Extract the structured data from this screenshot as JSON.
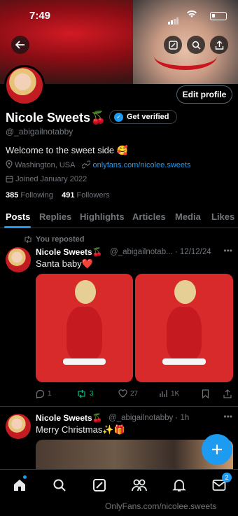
{
  "status_bar": {
    "time": "7:49"
  },
  "profile": {
    "name": "Nicole Sweets🍒",
    "handle": "@_abigailnotabby",
    "get_verified_label": "Get verified",
    "edit_profile_label": "Edit profile",
    "bio": "Welcome to the sweet side 🥰",
    "location": "Washington, USA",
    "website": "onlyfans.com/nicolee.sweets",
    "joined": "Joined January 2022",
    "following_count": "385",
    "following_label": "Following",
    "followers_count": "491",
    "followers_label": "Followers"
  },
  "tabs": [
    {
      "label": "Posts"
    },
    {
      "label": "Replies"
    },
    {
      "label": "Highlights"
    },
    {
      "label": "Articles"
    },
    {
      "label": "Media"
    },
    {
      "label": "Likes"
    }
  ],
  "posts": [
    {
      "repost_label": "You reposted",
      "author": "Nicole Sweets🍒",
      "meta": "@_abigailnotab... · 12/12/24",
      "text": "Santa baby❤️",
      "replies": "1",
      "reposts": "3",
      "likes": "27",
      "views": "1K"
    },
    {
      "author": "Nicole Sweets🍒",
      "meta": "@_abigailnotabby · 1h",
      "text": "Merry Christmas✨🎁"
    }
  ],
  "messages_badge": "2",
  "watermark": "OnlyFans.com/nicolee.sweets",
  "colors": {
    "accent": "#1d9bf0",
    "repost_green": "#00ba7c",
    "muted": "#71767b"
  }
}
